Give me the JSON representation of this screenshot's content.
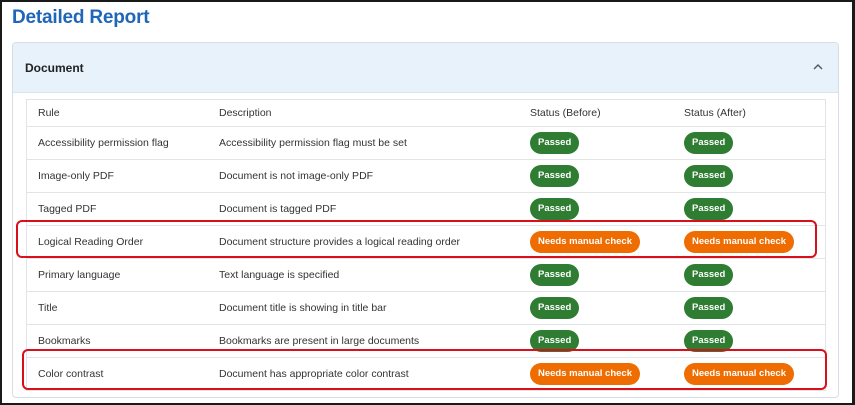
{
  "page_title": "Detailed Report",
  "section": {
    "title": "Document"
  },
  "table": {
    "headers": [
      "Rule",
      "Description",
      "Status (Before)",
      "Status (After)"
    ],
    "rows": [
      {
        "rule": "Accessibility permission flag",
        "description": "Accessibility permission flag must be set",
        "before": "Passed",
        "after": "Passed",
        "before_status": "pass",
        "after_status": "pass"
      },
      {
        "rule": "Image-only PDF",
        "description": "Document is not image-only PDF",
        "before": "Passed",
        "after": "Passed",
        "before_status": "pass",
        "after_status": "pass"
      },
      {
        "rule": "Tagged PDF",
        "description": "Document is tagged PDF",
        "before": "Passed",
        "after": "Passed",
        "before_status": "pass",
        "after_status": "pass"
      },
      {
        "rule": "Logical Reading Order",
        "description": "Document structure provides a logical reading order",
        "before": "Needs manual check",
        "after": "Needs manual check",
        "before_status": "warn",
        "after_status": "warn"
      },
      {
        "rule": "Primary language",
        "description": "Text language is specified",
        "before": "Passed",
        "after": "Passed",
        "before_status": "pass",
        "after_status": "pass"
      },
      {
        "rule": "Title",
        "description": "Document title is showing in title bar",
        "before": "Passed",
        "after": "Passed",
        "before_status": "pass",
        "after_status": "pass"
      },
      {
        "rule": "Bookmarks",
        "description": "Bookmarks are present in large documents",
        "before": "Passed",
        "after": "Passed",
        "before_status": "pass",
        "after_status": "pass"
      },
      {
        "rule": "Color contrast",
        "description": "Document has appropriate color contrast",
        "before": "Needs manual check",
        "after": "Needs manual check",
        "before_status": "warn",
        "after_status": "warn"
      }
    ]
  },
  "colors": {
    "title": "#1f66b8",
    "passed": "#2e7d32",
    "needs_check": "#ef6c00",
    "highlight": "#d90f1a",
    "header_bg": "#e7f2fb"
  }
}
